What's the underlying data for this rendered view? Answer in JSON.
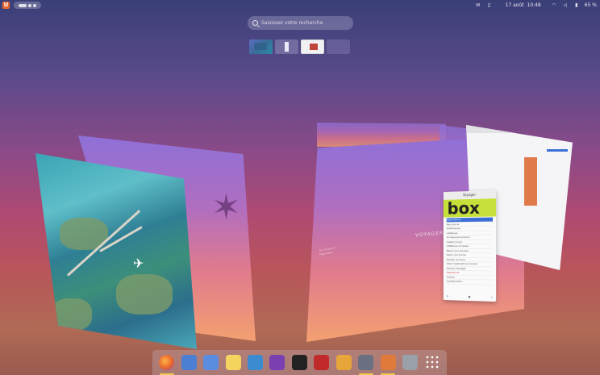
{
  "topbar": {
    "app_badge": "U",
    "date": "17 août",
    "time": "10:48",
    "battery": "65 %",
    "icons": [
      "mail-icon",
      "document-icon",
      "wifi-icon",
      "volume-icon",
      "battery-icon"
    ]
  },
  "search": {
    "placeholder": "Saisissez votre recherche"
  },
  "windows": {
    "voyager_brand": "VOYAGER",
    "voyager_subtitle": "Du Simple au Magnifique",
    "app_title": "Voyager",
    "app_logo": "box",
    "app_menu": [
      "Applications",
      "Raccourcis",
      "Préférences",
      "Utilitaires",
      "Accessoires Gnome",
      "Gestion Grub",
      "Utilitaires à Caisse",
      "Mise à jour Docker",
      "Saisir une Iconie",
      "Ajouter au Dock",
      "Saisir Applications Gnome",
      "Session Voyager",
      "Apparence",
      "Thème",
      "Configuration"
    ],
    "app_menu_selected": 0
  },
  "dock": {
    "items": [
      {
        "name": "firefox",
        "color": "#e8662c",
        "active": true
      },
      {
        "name": "files",
        "color": "#4a7fd4",
        "active": false
      },
      {
        "name": "text-editor",
        "color": "#5a8ce0",
        "active": false
      },
      {
        "name": "notes",
        "color": "#f4d35e",
        "active": false
      },
      {
        "name": "software-store",
        "color": "#3b8bd0",
        "active": false
      },
      {
        "name": "video-editor",
        "color": "#7a3fb0",
        "active": false
      },
      {
        "name": "bluefish",
        "color": "#222222",
        "active": false
      },
      {
        "name": "pdf-viewer",
        "color": "#c02a2a",
        "active": false
      },
      {
        "name": "podcast",
        "color": "#e8a53a",
        "active": false
      },
      {
        "name": "voyager-app",
        "color": "#6a7080",
        "active": true
      },
      {
        "name": "workspaces",
        "color": "#e07a3a",
        "active": true
      },
      {
        "name": "trash",
        "color": "#9aa0a8",
        "active": false
      },
      {
        "name": "app-grid",
        "color": "#ffffff",
        "active": false
      }
    ]
  }
}
